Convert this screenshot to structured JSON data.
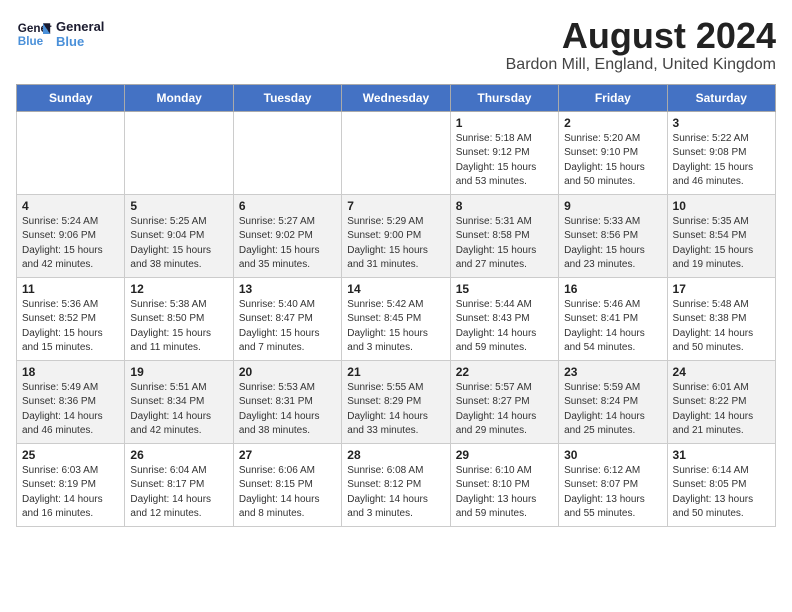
{
  "header": {
    "logo_line1": "General",
    "logo_line2": "Blue",
    "title": "August 2024",
    "subtitle": "Bardon Mill, England, United Kingdom"
  },
  "weekdays": [
    "Sunday",
    "Monday",
    "Tuesday",
    "Wednesday",
    "Thursday",
    "Friday",
    "Saturday"
  ],
  "weeks": [
    [
      {
        "day": "",
        "info": ""
      },
      {
        "day": "",
        "info": ""
      },
      {
        "day": "",
        "info": ""
      },
      {
        "day": "",
        "info": ""
      },
      {
        "day": "1",
        "info": "Sunrise: 5:18 AM\nSunset: 9:12 PM\nDaylight: 15 hours\nand 53 minutes."
      },
      {
        "day": "2",
        "info": "Sunrise: 5:20 AM\nSunset: 9:10 PM\nDaylight: 15 hours\nand 50 minutes."
      },
      {
        "day": "3",
        "info": "Sunrise: 5:22 AM\nSunset: 9:08 PM\nDaylight: 15 hours\nand 46 minutes."
      }
    ],
    [
      {
        "day": "4",
        "info": "Sunrise: 5:24 AM\nSunset: 9:06 PM\nDaylight: 15 hours\nand 42 minutes."
      },
      {
        "day": "5",
        "info": "Sunrise: 5:25 AM\nSunset: 9:04 PM\nDaylight: 15 hours\nand 38 minutes."
      },
      {
        "day": "6",
        "info": "Sunrise: 5:27 AM\nSunset: 9:02 PM\nDaylight: 15 hours\nand 35 minutes."
      },
      {
        "day": "7",
        "info": "Sunrise: 5:29 AM\nSunset: 9:00 PM\nDaylight: 15 hours\nand 31 minutes."
      },
      {
        "day": "8",
        "info": "Sunrise: 5:31 AM\nSunset: 8:58 PM\nDaylight: 15 hours\nand 27 minutes."
      },
      {
        "day": "9",
        "info": "Sunrise: 5:33 AM\nSunset: 8:56 PM\nDaylight: 15 hours\nand 23 minutes."
      },
      {
        "day": "10",
        "info": "Sunrise: 5:35 AM\nSunset: 8:54 PM\nDaylight: 15 hours\nand 19 minutes."
      }
    ],
    [
      {
        "day": "11",
        "info": "Sunrise: 5:36 AM\nSunset: 8:52 PM\nDaylight: 15 hours\nand 15 minutes."
      },
      {
        "day": "12",
        "info": "Sunrise: 5:38 AM\nSunset: 8:50 PM\nDaylight: 15 hours\nand 11 minutes."
      },
      {
        "day": "13",
        "info": "Sunrise: 5:40 AM\nSunset: 8:47 PM\nDaylight: 15 hours\nand 7 minutes."
      },
      {
        "day": "14",
        "info": "Sunrise: 5:42 AM\nSunset: 8:45 PM\nDaylight: 15 hours\nand 3 minutes."
      },
      {
        "day": "15",
        "info": "Sunrise: 5:44 AM\nSunset: 8:43 PM\nDaylight: 14 hours\nand 59 minutes."
      },
      {
        "day": "16",
        "info": "Sunrise: 5:46 AM\nSunset: 8:41 PM\nDaylight: 14 hours\nand 54 minutes."
      },
      {
        "day": "17",
        "info": "Sunrise: 5:48 AM\nSunset: 8:38 PM\nDaylight: 14 hours\nand 50 minutes."
      }
    ],
    [
      {
        "day": "18",
        "info": "Sunrise: 5:49 AM\nSunset: 8:36 PM\nDaylight: 14 hours\nand 46 minutes."
      },
      {
        "day": "19",
        "info": "Sunrise: 5:51 AM\nSunset: 8:34 PM\nDaylight: 14 hours\nand 42 minutes."
      },
      {
        "day": "20",
        "info": "Sunrise: 5:53 AM\nSunset: 8:31 PM\nDaylight: 14 hours\nand 38 minutes."
      },
      {
        "day": "21",
        "info": "Sunrise: 5:55 AM\nSunset: 8:29 PM\nDaylight: 14 hours\nand 33 minutes."
      },
      {
        "day": "22",
        "info": "Sunrise: 5:57 AM\nSunset: 8:27 PM\nDaylight: 14 hours\nand 29 minutes."
      },
      {
        "day": "23",
        "info": "Sunrise: 5:59 AM\nSunset: 8:24 PM\nDaylight: 14 hours\nand 25 minutes."
      },
      {
        "day": "24",
        "info": "Sunrise: 6:01 AM\nSunset: 8:22 PM\nDaylight: 14 hours\nand 21 minutes."
      }
    ],
    [
      {
        "day": "25",
        "info": "Sunrise: 6:03 AM\nSunset: 8:19 PM\nDaylight: 14 hours\nand 16 minutes."
      },
      {
        "day": "26",
        "info": "Sunrise: 6:04 AM\nSunset: 8:17 PM\nDaylight: 14 hours\nand 12 minutes."
      },
      {
        "day": "27",
        "info": "Sunrise: 6:06 AM\nSunset: 8:15 PM\nDaylight: 14 hours\nand 8 minutes."
      },
      {
        "day": "28",
        "info": "Sunrise: 6:08 AM\nSunset: 8:12 PM\nDaylight: 14 hours\nand 3 minutes."
      },
      {
        "day": "29",
        "info": "Sunrise: 6:10 AM\nSunset: 8:10 PM\nDaylight: 13 hours\nand 59 minutes."
      },
      {
        "day": "30",
        "info": "Sunrise: 6:12 AM\nSunset: 8:07 PM\nDaylight: 13 hours\nand 55 minutes."
      },
      {
        "day": "31",
        "info": "Sunrise: 6:14 AM\nSunset: 8:05 PM\nDaylight: 13 hours\nand 50 minutes."
      }
    ]
  ]
}
